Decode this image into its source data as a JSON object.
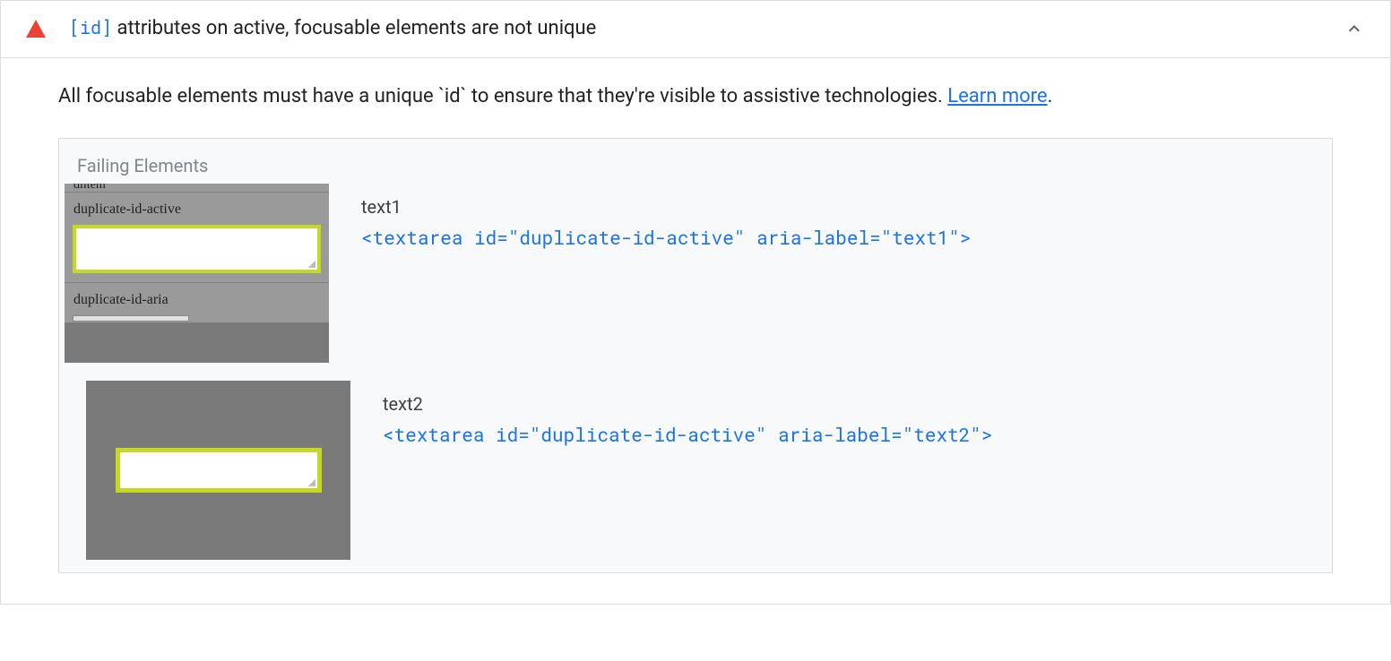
{
  "audit": {
    "title_code": "[id]",
    "title_rest": " attributes on active, focusable elements are not unique",
    "description": "All focusable elements must have a unique `id` to ensure that they're visible to assistive technologies. ",
    "learn_more": "Learn more",
    "failing_title": "Failing Elements",
    "thumbs": {
      "t1_trunc": "dlitem",
      "t1_label1": "duplicate-id-active",
      "t1_label2": "duplicate-id-aria"
    },
    "rows": [
      {
        "label": "text1",
        "code": "<textarea id=\"duplicate-id-active\" aria-label=\"text1\">"
      },
      {
        "label": "text2",
        "code": "<textarea id=\"duplicate-id-active\" aria-label=\"text2\">"
      }
    ]
  }
}
